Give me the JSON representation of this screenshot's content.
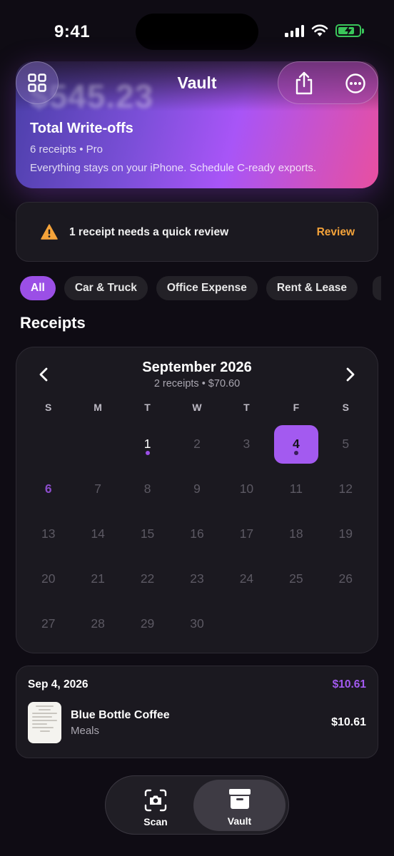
{
  "status": {
    "time": "9:41"
  },
  "header": {
    "title": "Vault"
  },
  "hero": {
    "amount": "$545.23",
    "title": "Total Write-offs",
    "subtitle": "6 receipts • Pro",
    "note": "Everything stays on your iPhone. Schedule C-ready exports."
  },
  "review": {
    "message": "1 receipt needs a quick review",
    "action": "Review"
  },
  "filters": {
    "all": "All",
    "car": "Car & Truck",
    "office": "Office Expense",
    "rent": "Rent & Lease"
  },
  "receipts_heading": "Receipts",
  "calendar": {
    "month": "September 2026",
    "summary": "2 receipts • $70.60",
    "weekdays": [
      "S",
      "M",
      "T",
      "W",
      "T",
      "F",
      "S"
    ],
    "days_with_receipts": [
      1,
      4
    ],
    "selected_day": 4,
    "today": 6
  },
  "receipt_group": {
    "date": "Sep 4, 2026",
    "total": "$10.61",
    "item": {
      "merchant": "Blue Bottle Coffee",
      "category": "Meals",
      "amount": "$10.61"
    }
  },
  "tabs": {
    "scan": "Scan",
    "vault": "Vault"
  },
  "colors": {
    "accent": "#a35af0",
    "warning": "#f5a33a",
    "background": "#0f0c14"
  }
}
